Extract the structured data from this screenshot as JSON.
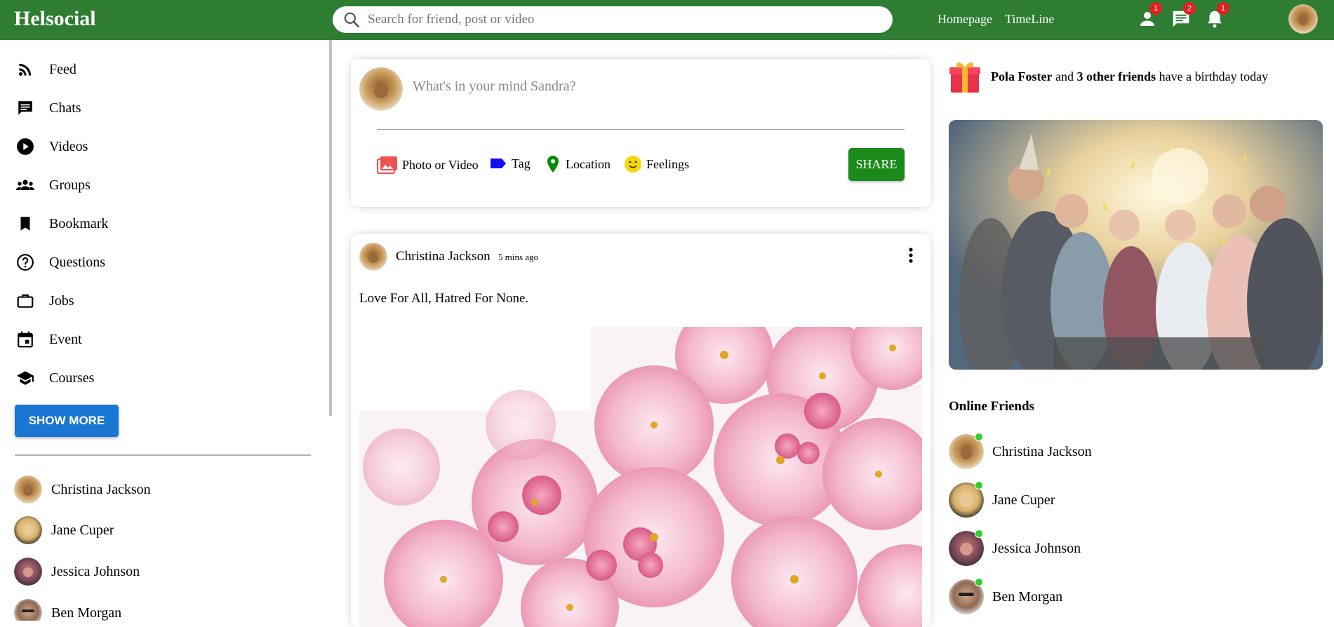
{
  "app": {
    "title": "Helsocial"
  },
  "search": {
    "placeholder": "Search for friend, post or video"
  },
  "topbar": {
    "links": [
      "Homepage",
      "TimeLine"
    ],
    "badges": {
      "friends": "1",
      "messages": "2",
      "notifications": "1"
    }
  },
  "sidebar": {
    "items": [
      {
        "label": "Feed",
        "icon": "rss-feed-icon"
      },
      {
        "label": "Chats",
        "icon": "chat-icon"
      },
      {
        "label": "Videos",
        "icon": "play-circle-icon"
      },
      {
        "label": "Groups",
        "icon": "group-icon"
      },
      {
        "label": "Bookmark",
        "icon": "bookmark-icon"
      },
      {
        "label": "Questions",
        "icon": "help-outline-icon"
      },
      {
        "label": "Jobs",
        "icon": "work-outline-icon"
      },
      {
        "label": "Event",
        "icon": "event-icon"
      },
      {
        "label": "Courses",
        "icon": "school-icon"
      }
    ],
    "show_more": "SHOW MORE",
    "friends": [
      "Christina Jackson",
      "Jane Cuper",
      "Jessica Johnson",
      "Ben Morgan"
    ]
  },
  "share": {
    "placeholder": "What's in your mind Sandra?",
    "options": [
      "Photo or Video",
      "Tag",
      "Location",
      "Feelings"
    ],
    "button": "SHARE"
  },
  "post": {
    "author": "Christina Jackson",
    "time": "5 mins ago",
    "text": "Love For All, Hatred For None."
  },
  "rightbar": {
    "birthday": {
      "name": "Pola Foster",
      "and": "and",
      "others": "3 other friends",
      "rest": "have a birthday today"
    },
    "online_title": "Online Friends",
    "online": [
      "Christina Jackson",
      "Jane Cuper",
      "Jessica Johnson",
      "Ben Morgan"
    ]
  },
  "colors": {
    "topbar": "#2e7d32",
    "showmore": "#1976d2",
    "share": "#1b8a1b",
    "online_dot": "#32cd32"
  }
}
